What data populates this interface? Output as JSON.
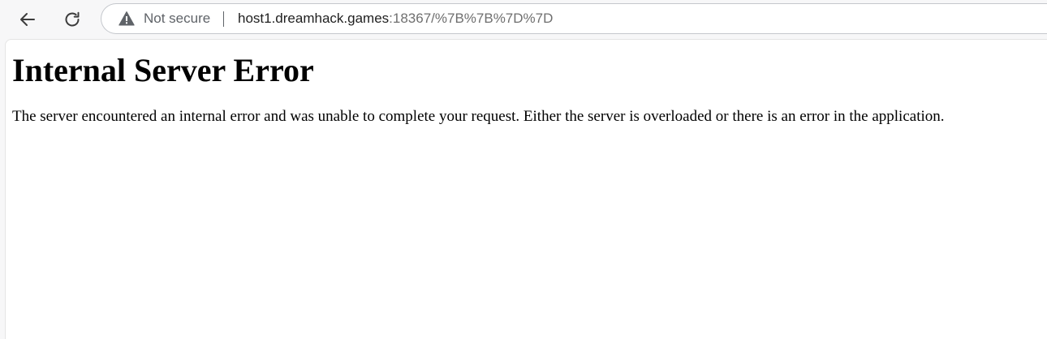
{
  "browser": {
    "nav": {
      "back_icon": "arrow-left-icon",
      "reload_icon": "reload-icon"
    },
    "omnibox": {
      "security_icon": "warning-triangle-icon",
      "security_label": "Not secure",
      "url_host": "host1.dreamhack.games",
      "url_rest": ":18367/%7B%7B%7D%7D"
    }
  },
  "page": {
    "heading": "Internal Server Error",
    "message": "The server encountered an internal error and was unable to complete your request. Either the server is overloaded or there is an error in the application."
  },
  "colors": {
    "chrome_background": "#f7f7f8",
    "page_background": "#ffffff",
    "secondary_text": "#5f6368",
    "text": "#000000"
  }
}
